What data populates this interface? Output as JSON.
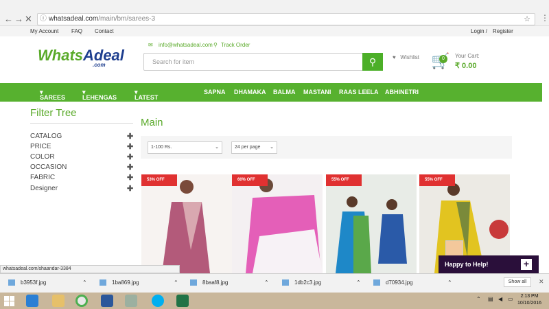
{
  "browser": {
    "url_host": "whatsadeal.com",
    "url_path": "/main/bm/sarees-3"
  },
  "topbar": {
    "my_account": "My Account",
    "faq": "FAQ",
    "contact": "Contact",
    "login": "Login /",
    "register": "Register"
  },
  "header": {
    "logo_main_1": "Whats",
    "logo_main_2": "Adeal",
    "logo_com": ".com",
    "email": "info@whatsadeal.com",
    "track": "Track Order",
    "search_placeholder": "Search for item",
    "wishlist": "Wishlist",
    "cart_count": "0",
    "cart_label": "Your Cart:",
    "cart_amount": "₹ 0.00"
  },
  "nav": [
    {
      "label": "SAREES",
      "dropdown": true
    },
    {
      "label": "LEHENGAS",
      "dropdown": true
    },
    {
      "label": "LATEST CATALOG",
      "dropdown": true
    },
    {
      "label": "SAPNA",
      "dropdown": false
    },
    {
      "label": "DHAMAKA",
      "dropdown": false
    },
    {
      "label": "BALMA",
      "dropdown": false
    },
    {
      "label": "MASTANI",
      "dropdown": false
    },
    {
      "label": "RAAS LEELA",
      "dropdown": false
    },
    {
      "label": "ABHINETRI",
      "dropdown": false
    }
  ],
  "filter": {
    "title": "Filter Tree",
    "items": [
      "CATALOG",
      "PRICE",
      "COLOR",
      "OCCASION",
      "FABRIC",
      "Designer"
    ]
  },
  "main": {
    "title": "Main",
    "price_select": "1-100 Rs.",
    "per_page_select": "24 per page"
  },
  "products": [
    {
      "discount": "53% OFF",
      "colors": [
        "#b35a7a",
        "#d9a8b0"
      ]
    },
    {
      "discount": "60% OFF",
      "colors": [
        "#e45fb8",
        "#f4f0f2"
      ]
    },
    {
      "discount": "55% OFF",
      "colors": [
        "#1e88c8",
        "#5aa84a"
      ]
    },
    {
      "discount": "55% OFF",
      "colors": [
        "#e2c420",
        "#7a8a3a"
      ]
    }
  ],
  "status_url": "whatsadeal.com/shaandar-3384",
  "help": {
    "label": "Happy to Help!"
  },
  "downloads": [
    "b3953f.jpg",
    "1ba869.jpg",
    "8baaf8.jpg",
    "1db2c3.jpg",
    "d70934.jpg"
  ],
  "downloads_showall": "Show all",
  "clock": {
    "time": "2:13 PM",
    "date": "10/10/2016"
  },
  "colors": {
    "brand_green": "#57b12f",
    "offer_red": "#e03131",
    "help_bg": "#2a0f3a"
  }
}
